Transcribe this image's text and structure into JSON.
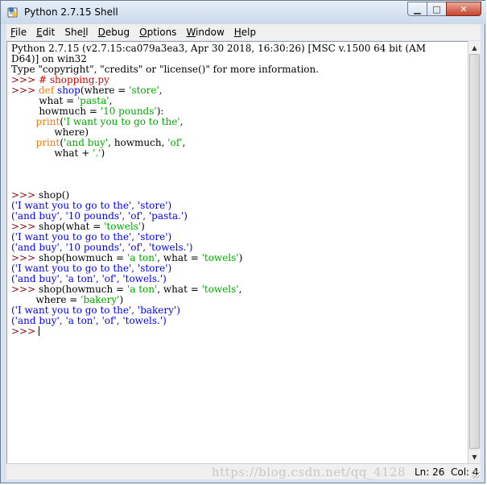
{
  "window": {
    "title": "Python 2.7.15 Shell",
    "minimize_label": "▁",
    "maximize_label": "□",
    "close_label": "✕"
  },
  "menu": {
    "file": {
      "key": "F",
      "rest": "ile"
    },
    "edit": {
      "key": "E",
      "rest": "dit"
    },
    "shell_pre": "She",
    "shell_key": "l",
    "shell_post": "l",
    "debug": {
      "key": "D",
      "rest": "ebug"
    },
    "options": {
      "key": "O",
      "rest": "ptions"
    },
    "window_menu": {
      "key": "W",
      "rest": "indow"
    },
    "help": {
      "key": "H",
      "rest": "elp"
    }
  },
  "shell": {
    "prompt": ">>> ",
    "banner1": "Python 2.7.15 (v2.7.15:ca079a3ea3, Apr 30 2018, 16:30:26) [MSC v.1500 64 bit (AM",
    "banner2": "D64)] on win32",
    "banner3": "Type \"copyright\", \"credits\" or \"license()\" for more information.",
    "comment": "# shopping.py",
    "def_kw": "def",
    "func_name": "shop",
    "d1a": "(where = ",
    "d1s": "'store'",
    "d1b": ",",
    "d2a": "         what = ",
    "d2s": "'pasta'",
    "d2b": ",",
    "d3a": "         howmuch = ",
    "d3s": "'10 pounds'",
    "d3b": "):",
    "indent1": "        ",
    "print_kw": "print",
    "p1a": "(",
    "p1s": "'I want you to go to the'",
    "p1b": ",",
    "p2a": "              where)",
    "p3s": "'and buy'",
    "p3b": ", howmuch, ",
    "p3s2": "'of'",
    "p3c": ",",
    "p4a": "              what + ",
    "p4s": "'.'",
    "p4b": ")",
    "call1": "shop()",
    "o1": "('I want you to go to the', 'store')",
    "o2": "('and buy', '10 pounds', 'of', 'pasta.')",
    "call2a": "shop(what = ",
    "call2s": "'towels'",
    "call2b": ")",
    "o3": "('I want you to go to the', 'store')",
    "o4": "('and buy', '10 pounds', 'of', 'towels.')",
    "call3a": "shop(howmuch = ",
    "call3s": "'a ton'",
    "call3b": ", what = ",
    "call3s2": "'towels'",
    "call3c": ")",
    "o5": "('I want you to go to the', 'store')",
    "o6": "('and buy', 'a ton', 'of', 'towels.')",
    "call4a": "shop(howmuch = ",
    "call4s": "'a ton'",
    "call4b": ", what = ",
    "call4s2": "'towels'",
    "call4c": ",",
    "call4d": "        where = ",
    "call4s3": "'bakery'",
    "call4e": ")",
    "o7": "('I want you to go to the', 'bakery')",
    "o8": "('and buy', 'a ton', 'of', 'towels.')"
  },
  "status": {
    "watermark": "https://blog.csdn.net/qq_4128",
    "line": "Ln: 26",
    "column": "Col: 4"
  }
}
